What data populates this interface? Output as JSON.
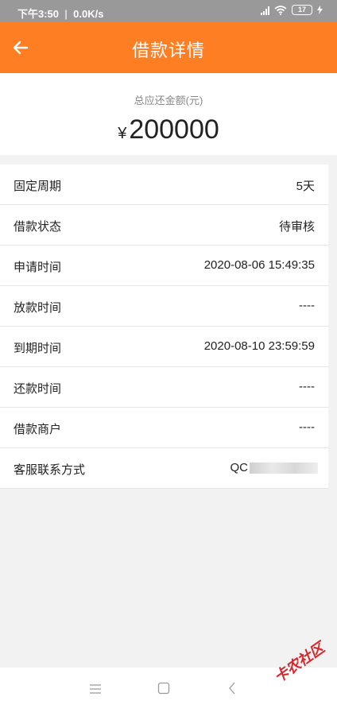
{
  "status_bar": {
    "time": "下午3:50",
    "speed": "0.0K/s",
    "battery": "17"
  },
  "header": {
    "back_icon": "arrow-left-icon",
    "title": "借款详情"
  },
  "amount": {
    "label": "总应还金额(元)",
    "currency": "¥",
    "value": "200000"
  },
  "details": [
    {
      "label": "固定周期",
      "value": "5天"
    },
    {
      "label": "借款状态",
      "value": "待审核"
    },
    {
      "label": "申请时间",
      "value": "2020-08-06 15:49:35"
    },
    {
      "label": "放款时间",
      "value": "----"
    },
    {
      "label": "到期时间",
      "value": "2020-08-10 23:59:59"
    },
    {
      "label": "还款时间",
      "value": "----"
    },
    {
      "label": "借款商户",
      "value": "----"
    },
    {
      "label": "客服联系方式",
      "value": "QC"
    }
  ],
  "nav": {
    "menu_icon": "menu-icon",
    "home_icon": "square-icon",
    "back_icon": "chevron-left-icon"
  },
  "watermark": "卡农社区",
  "colors": {
    "header": "#fd7e23",
    "status_bar": "#999999",
    "background": "#f2f2f2"
  }
}
